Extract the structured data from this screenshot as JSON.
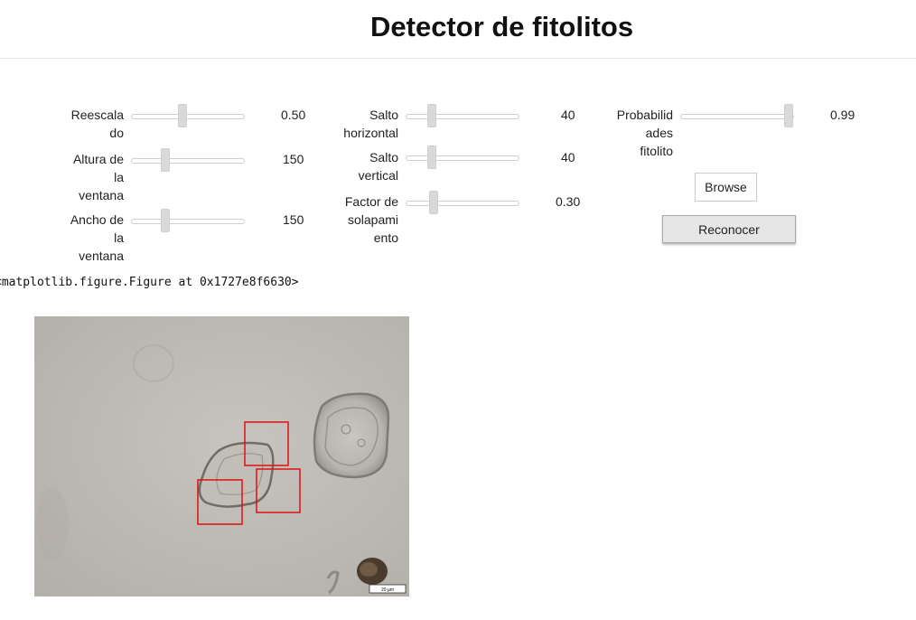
{
  "header": {
    "title": "Detector de fitolitos"
  },
  "sliders": [
    {
      "id": "reescalado",
      "label_lines": [
        "Reescala",
        "do"
      ],
      "value": "0.50",
      "fraction": 0.5
    },
    {
      "id": "altura",
      "label_lines": [
        "Altura de",
        "la",
        "ventana"
      ],
      "value": "150",
      "fraction": 0.3
    },
    {
      "id": "ancho",
      "label_lines": [
        "Ancho de",
        "la",
        "ventana"
      ],
      "value": "150",
      "fraction": 0.3
    },
    {
      "id": "salto_h",
      "label_lines": [
        "Salto",
        "horizontal"
      ],
      "value": "40",
      "fraction": 0.2
    },
    {
      "id": "salto_v",
      "label_lines": [
        "Salto",
        "vertical"
      ],
      "value": "40",
      "fraction": 0.2
    },
    {
      "id": "solapamiento",
      "label_lines": [
        "Factor de",
        "solapami",
        "ento"
      ],
      "value": "0.30",
      "fraction": 0.22
    },
    {
      "id": "probabilidades",
      "label_lines": [
        "Probabilid",
        "ades",
        "fitolito"
      ],
      "value": "0.99",
      "fraction": 0.99
    }
  ],
  "buttons": {
    "browse": "Browse",
    "reconocer": "Reconocer"
  },
  "output": {
    "figure_repr": "<matplotlib.figure.Figure at 0x1727e8f6630>"
  },
  "figure": {
    "scale_bar_label": "20 µm",
    "detection_box_color": "#dd1111",
    "detections": 3
  }
}
